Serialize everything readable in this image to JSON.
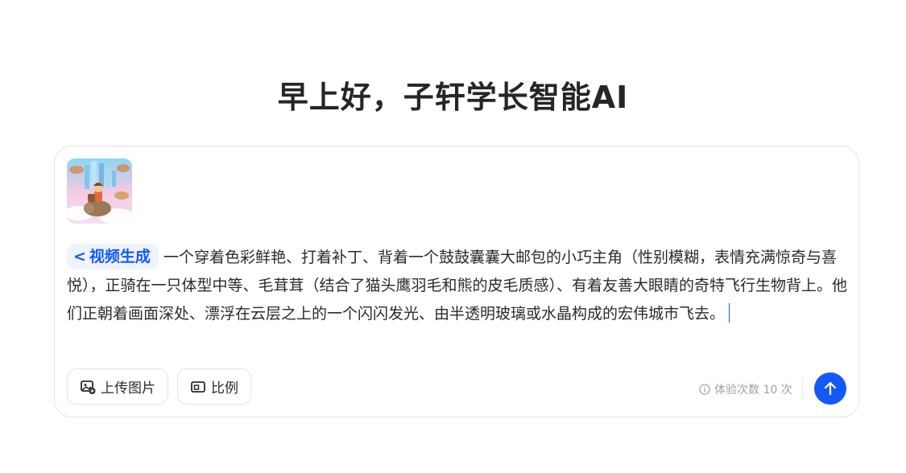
{
  "header": {
    "greeting": "早上好，子轩学长智能AI"
  },
  "composer": {
    "thumbnail_icon": "generated-image-thumbnail",
    "mode_chip": {
      "icon": "chevron-left-icon",
      "label": "视频生成",
      "color": "#1559f5"
    },
    "prompt_text": "一个穿着色彩鲜艳、打着补丁、背着一个鼓鼓囊囊大邮包的小巧主角（性别模糊，表情充满惊奇与喜悦），正骑在一只体型中等、毛茸茸（结合了猫头鹰羽毛和熊的皮毛质感）、有着友善大眼睛的奇特飞行生物背上。他们正朝着画面深处、漂浮在云层之上的一个闪闪发光、由半透明玻璃或水晶构成的宏伟城市飞去。",
    "upload_button": {
      "label": "上传图片",
      "icon": "image-upload-icon"
    },
    "ratio_button": {
      "label": "比例",
      "icon": "aspect-ratio-icon"
    },
    "quota": {
      "icon": "info-icon",
      "text": "体验次数 10 次"
    },
    "send_button": {
      "icon": "arrow-up-icon",
      "color": "#1559f5"
    }
  }
}
